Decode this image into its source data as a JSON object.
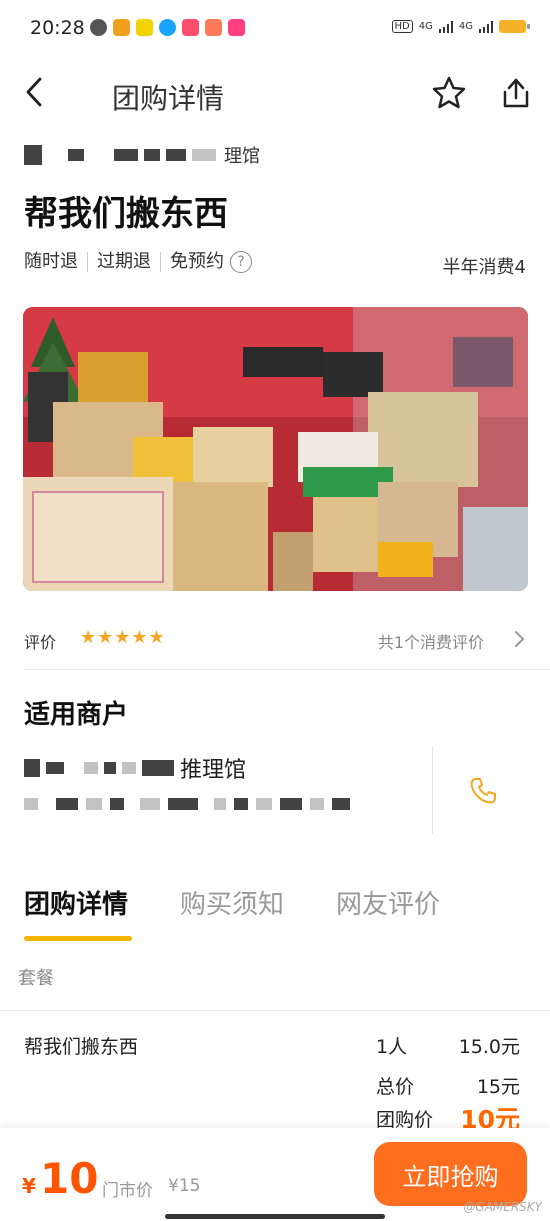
{
  "status_bar": {
    "time": "20:28",
    "network_1": "4G",
    "network_2": "4G",
    "hd_badge": "HD"
  },
  "nav": {
    "title": "团购详情"
  },
  "merchant_header": {
    "name_suffix": "理馆"
  },
  "deal": {
    "title": "帮我们搬东西",
    "policies": [
      "随时退",
      "过期退",
      "免预约"
    ],
    "help_glyph": "?",
    "sales": "半年消费4"
  },
  "rating": {
    "label": "评价",
    "stars": "★★★★★",
    "stars_value": 5,
    "review_count": "共1个消费评价"
  },
  "merchant_section": {
    "title": "适用商户",
    "name_suffix": "推理馆"
  },
  "tabs": [
    {
      "label": "团购详情",
      "active": true
    },
    {
      "label": "购买须知",
      "active": false
    },
    {
      "label": "网友评价",
      "active": false
    }
  ],
  "package": {
    "section_label": "套餐",
    "item_name": "帮我们搬东西",
    "item_qty": "1人",
    "item_price": "15.0元",
    "total_label": "总价",
    "total_value": "15元",
    "group_price_label": "团购价",
    "group_price_value": "10元"
  },
  "bottom": {
    "currency": "¥",
    "price": "10",
    "market_label": "门市价",
    "market_price": "¥15",
    "buy_label": "立即抢购",
    "watermark": "@GAMERSKY"
  },
  "colors": {
    "accent_orange": "#ff6d1f",
    "price_orange": "#ff5500",
    "star_gold": "#f5a623",
    "tab_underline": "#f5b400"
  }
}
